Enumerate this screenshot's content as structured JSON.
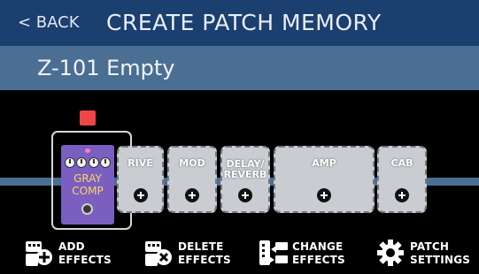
{
  "header": {
    "back_label": "< BACK",
    "title": "CREATE PATCH MEMORY"
  },
  "patch": {
    "name": "Z-101 Empty"
  },
  "effects": {
    "selected": {
      "name_line1": "GRAY",
      "name_line2": "COMP",
      "color": "#7a5fc1",
      "text_color": "#ffd35a"
    },
    "slots": [
      {
        "label": "DRIVE",
        "display": "RIVE"
      },
      {
        "label": "MOD",
        "display": "MOD"
      },
      {
        "label": "DELAY/\nREVERB",
        "display": "DELAY/\nREVERB"
      },
      {
        "label": "AMP",
        "display": "AMP"
      },
      {
        "label": "CAB",
        "display": "CAB"
      }
    ]
  },
  "footer": {
    "add": {
      "line1": "ADD",
      "line2": "EFFECTS",
      "icon": "add-effects-icon"
    },
    "delete": {
      "line1": "DELETE",
      "line2": "EFFECTS",
      "icon": "delete-effects-icon"
    },
    "change": {
      "line1": "CHANGE",
      "line2": "EFFECTS",
      "icon": "change-effects-icon"
    },
    "settings": {
      "line1": "PATCH",
      "line2": "SETTINGS",
      "icon": "gear-icon"
    }
  },
  "colors": {
    "header_bg": "#1b3f6e",
    "namebar_bg": "#4a6f93",
    "slot_bg": "#c9cdd2",
    "indicator": "#f04545"
  }
}
